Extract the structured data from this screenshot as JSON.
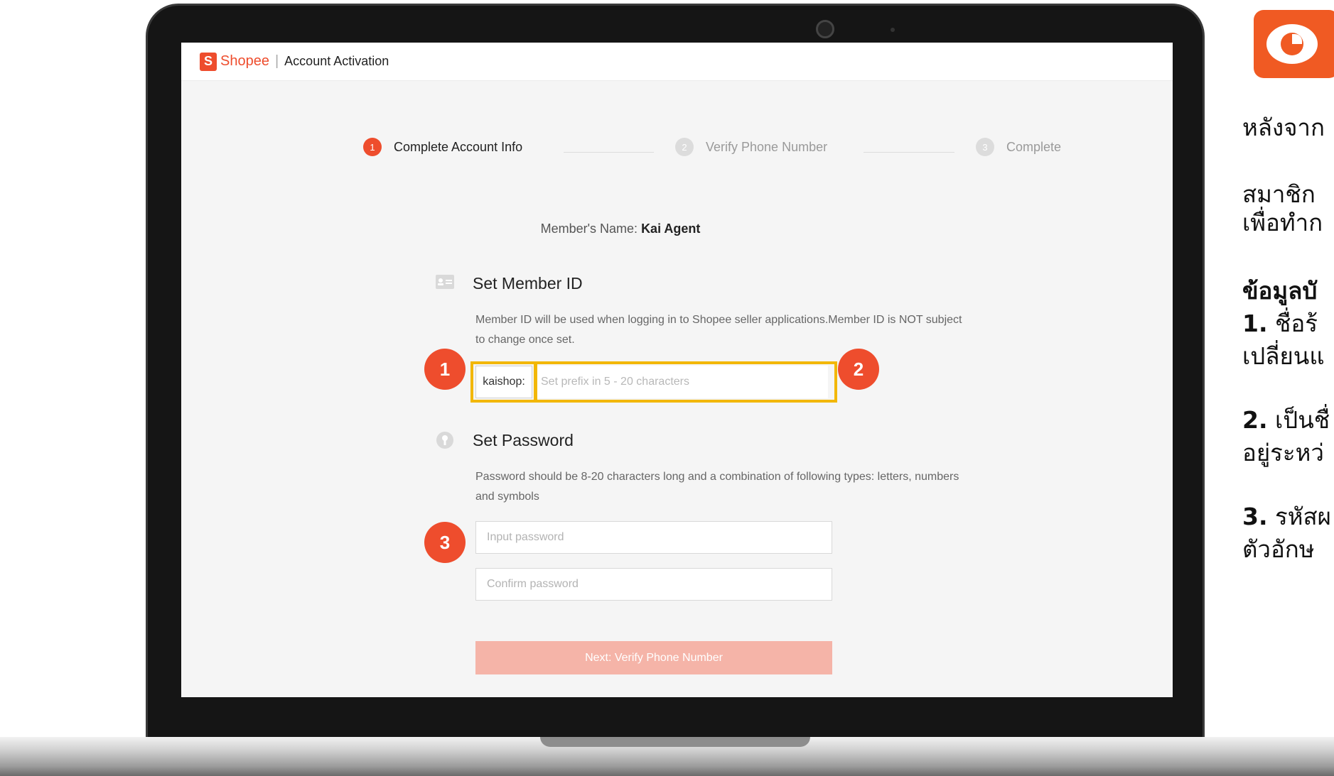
{
  "app": {
    "brand": "Shopee",
    "logo_letter": "S",
    "separator": "|",
    "page_title": "Account Activation"
  },
  "steps": [
    {
      "num": "1",
      "label": "Complete Account Info",
      "state": "active"
    },
    {
      "num": "2",
      "label": "Verify Phone Number",
      "state": "inactive"
    },
    {
      "num": "3",
      "label": "Complete",
      "state": "inactive"
    }
  ],
  "member": {
    "label": "Member's Name:",
    "name": "Kai Agent"
  },
  "member_id": {
    "title": "Set Member ID",
    "description": "Member ID will be used when logging in to Shopee seller applications.Member ID is NOT subject to change once set.",
    "prefix": "kaishop:",
    "placeholder": "Set prefix in 5 - 20 characters"
  },
  "password": {
    "title": "Set Password",
    "description": "Password should be 8-20 characters long and a combination of following types: letters, numbers and symbols",
    "input_placeholder": "Input password",
    "confirm_placeholder": "Confirm password"
  },
  "next_button": "Next: Verify Phone Number",
  "markers": [
    "1",
    "2",
    "3"
  ],
  "right_panel": {
    "line1": "หลังจาก",
    "line2": "สมาชิก",
    "line3": "เพื่อทำก",
    "heading": "ข้อมูลบั",
    "item1_num": "1.",
    "item1_text": "ชื่อร้",
    "item1_cont": "เปลี่ยนแ",
    "item2_num": "2.",
    "item2_text": "เป็นชื่",
    "item2_cont": "อยู่ระหว่",
    "item3_num": "3.",
    "item3_text": "รหัสผ",
    "item3_cont": "ตัวอักษ"
  },
  "colors": {
    "brand": "#ee4d2d",
    "highlight": "#f2b705",
    "button_disabled": "#f5b4a8",
    "eye_box": "#f05a23"
  }
}
